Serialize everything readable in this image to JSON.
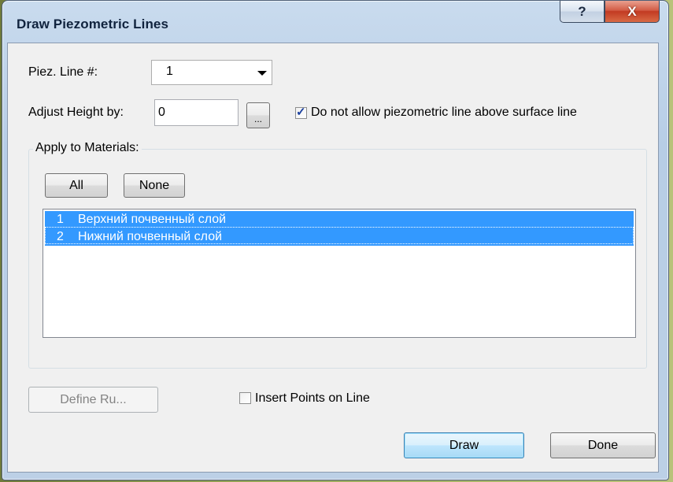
{
  "window": {
    "title": "Draw Piezometric Lines",
    "help_glyph": "?",
    "close_glyph": "X"
  },
  "piez_line": {
    "label": "Piez. Line #:",
    "value": "1"
  },
  "adjust_height": {
    "label": "Adjust Height by:",
    "value": "0",
    "browse_label": "..."
  },
  "no_above_surface": {
    "label": "Do not allow piezometric line above surface line",
    "checked": true
  },
  "materials": {
    "group_label": "Apply to Materials:",
    "all_label": "All",
    "none_label": "None",
    "items": [
      {
        "num": "1",
        "name": "Верхний почвенный слой",
        "selected": true
      },
      {
        "num": "2",
        "name": "Нижний почвенный слой",
        "selected": true
      }
    ]
  },
  "define_ru_label": "Define Ru...",
  "insert_points": {
    "label": "Insert Points on Line",
    "checked": false
  },
  "draw_label": "Draw",
  "done_label": "Done",
  "colors": {
    "selection": "#3399ff",
    "default_button_border": "#3c7fb1",
    "close_button": "#c23a22"
  }
}
